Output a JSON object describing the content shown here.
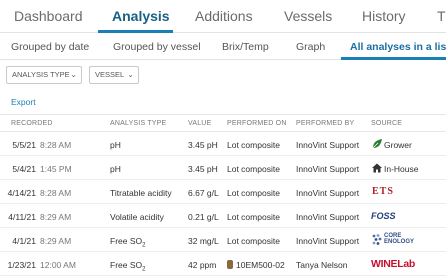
{
  "top_tabs": [
    "Dashboard",
    "Analysis",
    "Additions",
    "Vessels",
    "History"
  ],
  "sub_tabs": [
    "Grouped by date",
    "Grouped by vessel",
    "Brix/Temp",
    "Graph",
    "All analyses in a list"
  ],
  "filters": {
    "analysis_type": "ANALYSIS TYPE",
    "vessel": "VESSEL"
  },
  "export_label": "Export",
  "columns": [
    "RECORDED",
    "ANALYSIS TYPE",
    "VALUE",
    "PERFORMED ON",
    "PERFORMED BY",
    "SOURCE"
  ],
  "rows": [
    {
      "date": "5/5/21",
      "time": "8:28 AM",
      "type": "pH",
      "value": "3.45 pH",
      "performed_on": "Lot composite",
      "performed_by": "InnoVint Support",
      "source": "Grower",
      "source_icon": "leaf-icon"
    },
    {
      "date": "5/4/21",
      "time": "1:45 PM",
      "type": "pH",
      "value": "3.45 pH",
      "performed_on": "Lot composite",
      "performed_by": "InnoVint Support",
      "source": "In-House",
      "source_icon": "house-icon"
    },
    {
      "date": "4/14/21",
      "time": "8:28 AM",
      "type": "Titratable acidity",
      "value": "6.67 g/L",
      "performed_on": "Lot composite",
      "performed_by": "InnoVint Support",
      "source": "ETS",
      "source_icon": "ets-logo"
    },
    {
      "date": "4/11/21",
      "time": "8:29 AM",
      "type": "Volatile acidity",
      "value": "0.21 g/L",
      "performed_on": "Lot composite",
      "performed_by": "InnoVint Support",
      "source": "FOSS",
      "source_icon": "foss-logo"
    },
    {
      "date": "4/1/21",
      "time": "8:29 AM",
      "type": "Free SO",
      "type_sub": "2",
      "value": "32 mg/L",
      "performed_on": "Lot composite",
      "performed_by": "InnoVint Support",
      "source": "CORE ENOLOGY",
      "source_icon": "core-enology-logo"
    },
    {
      "date": "1/23/21",
      "time": "12:00 AM",
      "type": "Free SO",
      "type_sub": "2",
      "value": "42 ppm",
      "performed_on": "10EM500-02",
      "performed_by": "Tanya Nelson",
      "source": "WINELab",
      "source_icon": "winelab-logo"
    }
  ],
  "colors": {
    "accent": "#1a7fb5",
    "tab_active": "#1a5f86",
    "ets": "#b2202a",
    "foss": "#1f3f7a",
    "winelab_red": "#c8102e",
    "grower_green": "#2e7d32"
  }
}
